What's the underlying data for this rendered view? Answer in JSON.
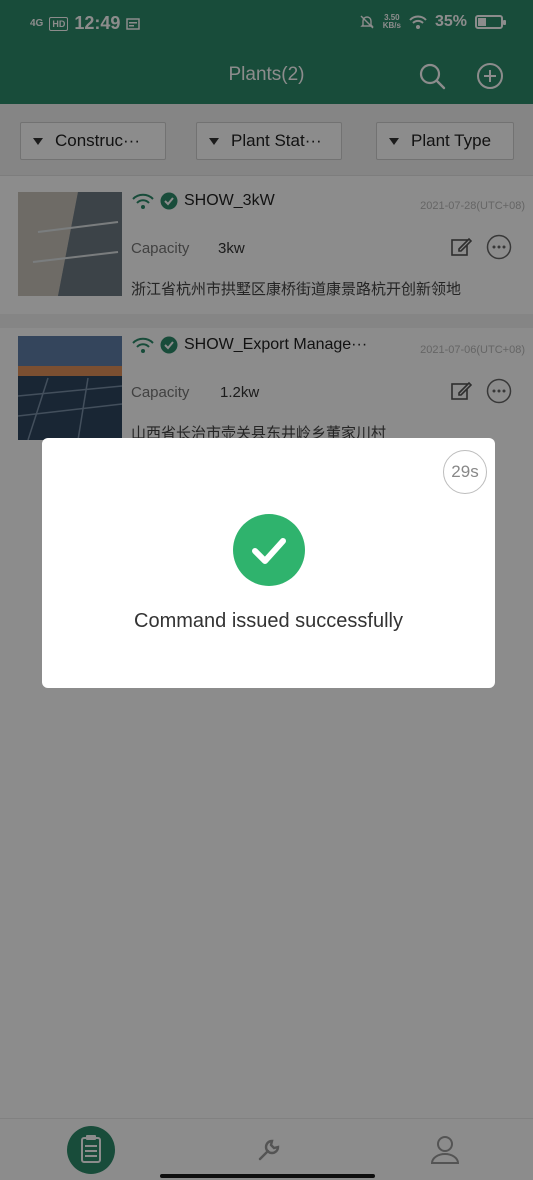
{
  "status_bar": {
    "network": "4G",
    "hd": "HD",
    "time": "12:49",
    "speed_value": "3.50",
    "speed_unit": "KB/s",
    "battery": "35%",
    "battery_level": 0.35
  },
  "header": {
    "title": "Plants(2)"
  },
  "filters": [
    {
      "label": "Construc···"
    },
    {
      "label": "Plant Stat···"
    },
    {
      "label": "Plant Type"
    }
  ],
  "plants": [
    {
      "name": "SHOW_3kW",
      "date": "2021-07-28(UTC+08)",
      "capacity_label": "Capacity",
      "capacity_value": "3kw",
      "address": "浙江省杭州市拱墅区康桥街道康景路杭开创新领地"
    },
    {
      "name": "SHOW_Export Manage···",
      "date": "2021-07-06(UTC+08)",
      "capacity_label": "Capacity",
      "capacity_value": "1.2kw",
      "address": "山西省长治市壶关县东井岭乡董家川村"
    }
  ],
  "dialog": {
    "countdown": "29s",
    "message": "Command issued successfully"
  },
  "colors": {
    "brand": "#2d8a6a",
    "success": "#2fb36d",
    "status_online": "#2d8a6a"
  }
}
